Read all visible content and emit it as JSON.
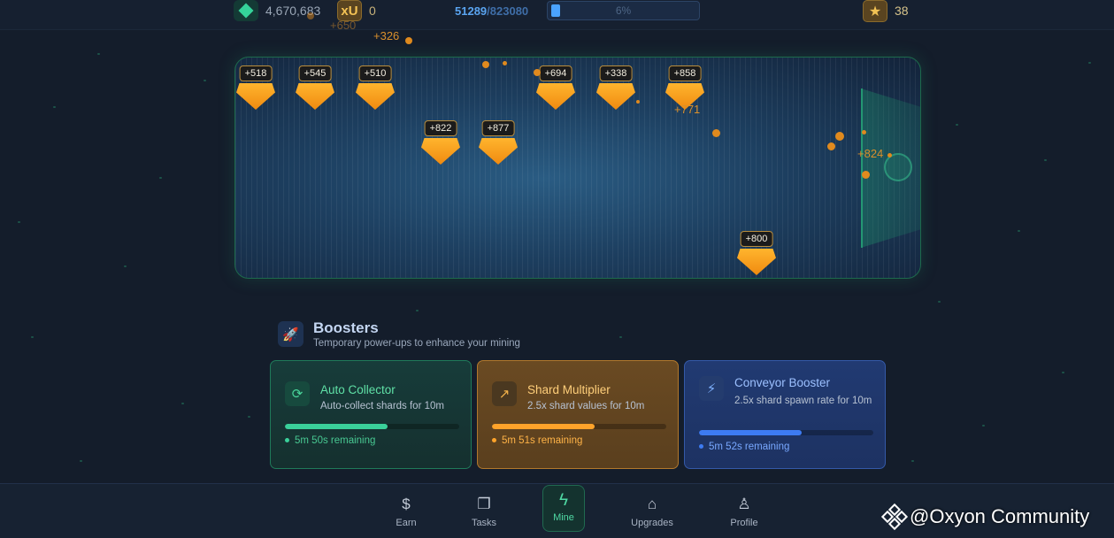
{
  "topbar": {
    "gem_icon": "gem-icon",
    "gem_count": "4,670,683",
    "xu_label": "xU",
    "xu_count": "0",
    "xp_current": "51289",
    "xp_sep": "/",
    "xp_total": "823080",
    "xp_percent_label": "6%",
    "xp_progress": 0.06,
    "star_icon": "star-icon",
    "level": "38"
  },
  "floating_pops": [
    "+326",
    "+650",
    "+771",
    "+824"
  ],
  "shards": [
    "+518",
    "+545",
    "+510",
    "+694",
    "+338",
    "+858",
    "+822",
    "+877",
    "+800"
  ],
  "boosters": {
    "icon": "rocket-icon",
    "title": "Boosters",
    "subtitle": "Temporary power-ups to enhance your mining",
    "cards": [
      {
        "icon": "refresh-icon",
        "name": "Auto Collector",
        "desc": "Auto-collect shards for 10m",
        "remaining": "5m 50s remaining",
        "progress": 0.59,
        "color": "#3ad09a"
      },
      {
        "icon": "trending-up-icon",
        "name": "Shard Multiplier",
        "desc": "2.5x shard values for 10m",
        "remaining": "5m 51s remaining",
        "progress": 0.59,
        "color": "#ffa32a"
      },
      {
        "icon": "lightning-icon",
        "name": "Conveyor Booster",
        "desc": "2.5x shard spawn rate for 10m",
        "remaining": "5m 52s remaining",
        "progress": 0.59,
        "color": "#3d7bf2"
      }
    ]
  },
  "nav": {
    "earn": "Earn",
    "tasks": "Tasks",
    "mine": "Mine",
    "upgrades": "Upgrades",
    "profile": "Profile"
  },
  "watermark": "@Oxyon Community"
}
